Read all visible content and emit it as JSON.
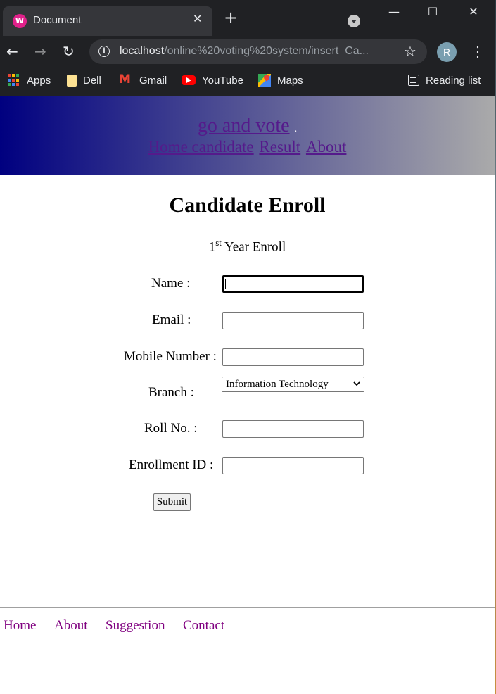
{
  "browser": {
    "tab_title": "Document",
    "tab_favicon_letter": "W",
    "new_tab_symbol": "+",
    "close_tab_symbol": "✕",
    "window_controls": {
      "minimize": "—",
      "maximize": "☐",
      "close": "✕"
    },
    "nav": {
      "back": "←",
      "forward": "→",
      "reload": "↻"
    },
    "url_host": "localhost",
    "url_path": "/online%20voting%20system/insert_Ca...",
    "star_symbol": "☆",
    "profile_initial": "R",
    "menu_symbol": "⋮",
    "bookmarks": [
      {
        "label": "Apps",
        "icon": "apps-grid-icon"
      },
      {
        "label": "Dell",
        "icon": "folder-icon"
      },
      {
        "label": "Gmail",
        "icon": "gmail-icon"
      },
      {
        "label": "YouTube",
        "icon": "youtube-icon"
      },
      {
        "label": "Maps",
        "icon": "maps-icon"
      }
    ],
    "reading_list": "Reading list",
    "colors": {
      "frame": "#202124",
      "tab_active": "#35363a",
      "favicon": "#e0218a"
    }
  },
  "site": {
    "title": "go and vote",
    "title_dot": ".",
    "nav": {
      "home_candidate": "Home candidate",
      "result": "Result",
      "about": "About"
    },
    "colors": {
      "banner_start": "#000080",
      "banner_end": "#aaaaaa",
      "link": "#551a8b"
    }
  },
  "form": {
    "heading": "Candidate Enroll",
    "subtitle_number": "1",
    "subtitle_sup": "st",
    "subtitle_text": "Year Enroll",
    "labels": {
      "name": "Name :",
      "email": "Email :",
      "mobile": "Mobile Number :",
      "branch": "Branch :",
      "roll": "Roll No. :",
      "enrollment": "Enrollment ID :"
    },
    "values": {
      "name": "",
      "email": "",
      "mobile": "",
      "roll": "",
      "enrollment": ""
    },
    "branch_selected": "Information Technology",
    "submit_label": "Submit"
  },
  "footer": {
    "links": {
      "home": "Home",
      "about": "About",
      "suggestion": "Suggestion",
      "contact": "Contact"
    },
    "link_color": "#800080"
  }
}
